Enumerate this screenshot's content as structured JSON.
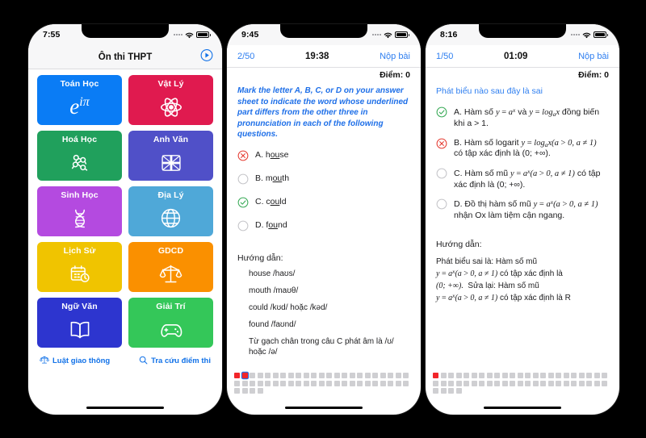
{
  "phone1": {
    "status": {
      "time": "7:55"
    },
    "navbar": {
      "title": "Ôn thi THPT",
      "action_icon": "play-circle-icon"
    },
    "tiles": [
      {
        "label": "Toán Học",
        "icon": "euler-formula-icon",
        "color": "#0a7cf5"
      },
      {
        "label": "Vật Lý",
        "icon": "atom-icon",
        "color": "#e01a4f"
      },
      {
        "label": "Hoá Học",
        "icon": "molecule-icon",
        "color": "#20a05c"
      },
      {
        "label": "Anh Văn",
        "icon": "union-jack-icon",
        "color": "#5050c8"
      },
      {
        "label": "Sinh Học",
        "icon": "dna-icon",
        "color": "#b44ae0"
      },
      {
        "label": "Địa Lý",
        "icon": "globe-icon",
        "color": "#4fa8d8"
      },
      {
        "label": "Lịch Sử",
        "icon": "calendar-clock-icon",
        "color": "#f0c400"
      },
      {
        "label": "GDCD",
        "icon": "scales-icon",
        "color": "#fa9000"
      },
      {
        "label": "Ngữ Văn",
        "icon": "open-book-icon",
        "color": "#2d35cf"
      },
      {
        "label": "Giải Trí",
        "icon": "gamepad-icon",
        "color": "#34c759"
      }
    ],
    "links": [
      {
        "label": "Luật giao thông",
        "icon": "scales-icon"
      },
      {
        "label": "Tra cứu điểm thi",
        "icon": "search-icon"
      }
    ],
    "accent": "#1272e8"
  },
  "phone2": {
    "status": {
      "time": "9:45"
    },
    "nav": {
      "index": "2/50",
      "timer": "19:38",
      "submit": "Nộp bài"
    },
    "score": "Điểm: 0",
    "prompt": "Mark the letter A, B, C, or D on your answer sheet to indicate the word whose underlined part differs from the other three in pronunciation in each of the following questions.",
    "options": [
      {
        "letter": "A.",
        "pre": "h",
        "mid": "ou",
        "post": "se",
        "state": "wrong"
      },
      {
        "letter": "B.",
        "pre": "m",
        "mid": "ou",
        "post": "th",
        "state": "empty"
      },
      {
        "letter": "C.",
        "pre": "c",
        "mid": "ou",
        "post": "ld",
        "state": "correct"
      },
      {
        "letter": "D.",
        "pre": "f",
        "mid": "ou",
        "post": "nd",
        "state": "empty"
      }
    ],
    "guide_title": "Hướng dẫn:",
    "guide_items": [
      "house /haʊs/",
      "mouth /maʊθ/",
      "could /kʊd/ hoặc /kəd/",
      "found /faʊnd/",
      "Từ gạch chân trong câu C phát âm là /ʊ/ hoặc /ə/"
    ],
    "grid": {
      "total": 50,
      "red": [
        0,
        1
      ],
      "current": 1
    }
  },
  "phone3": {
    "status": {
      "time": "8:16"
    },
    "nav": {
      "index": "1/50",
      "timer": "01:09",
      "submit": "Nộp bài"
    },
    "score": "Điểm: 0",
    "prompt": "Phát biểu nào sau đây là sai",
    "options": [
      {
        "letter": "A.",
        "state": "correct",
        "line1_pre": "Hàm số ",
        "line1_math": "y = a^x",
        "line1_mid": " và ",
        "line1_math2": "y = log_a x",
        "line1_post": " đồng biến",
        "line2": "khi a > 1."
      },
      {
        "letter": "B.",
        "state": "wrong",
        "line1_pre": "Hàm số logarit ",
        "line1_math": "y = log_a x(a > 0, a ≠ 1)",
        "line2": "có tập xác định là (0; +∞)."
      },
      {
        "letter": "C.",
        "state": "empty",
        "line1_pre": "Hàm số mũ ",
        "line1_math": "y = a^x(a > 0, a ≠ 1)",
        "line1_post": " có tập",
        "line2": "xác định là (0; +∞)."
      },
      {
        "letter": "D.",
        "state": "empty",
        "line1_pre": "Đồ thị hàm số mũ ",
        "line1_math": "y = a^x(a > 0, a ≠ 1)",
        "line2": "nhận Ox làm tiệm cận ngang."
      }
    ],
    "guide_title": "Hướng dẫn:",
    "guide_lines": [
      "Phát biểu sai là: Hàm số mũ",
      "y = a^x(a > 0, a ≠ 1) có tập xác định là",
      "(0; +∞).  Sửa lại: Hàm số mũ",
      "y = a^x(a > 0, a ≠ 1) có tập xác định là R"
    ],
    "grid": {
      "total": 50,
      "red": [
        0
      ],
      "current": -1
    }
  },
  "colors": {
    "blue_accent": "#2f7ff0",
    "correct_green": "#34a853",
    "wrong_red": "#e5392f",
    "cell_grey": "#cfcfd2"
  }
}
